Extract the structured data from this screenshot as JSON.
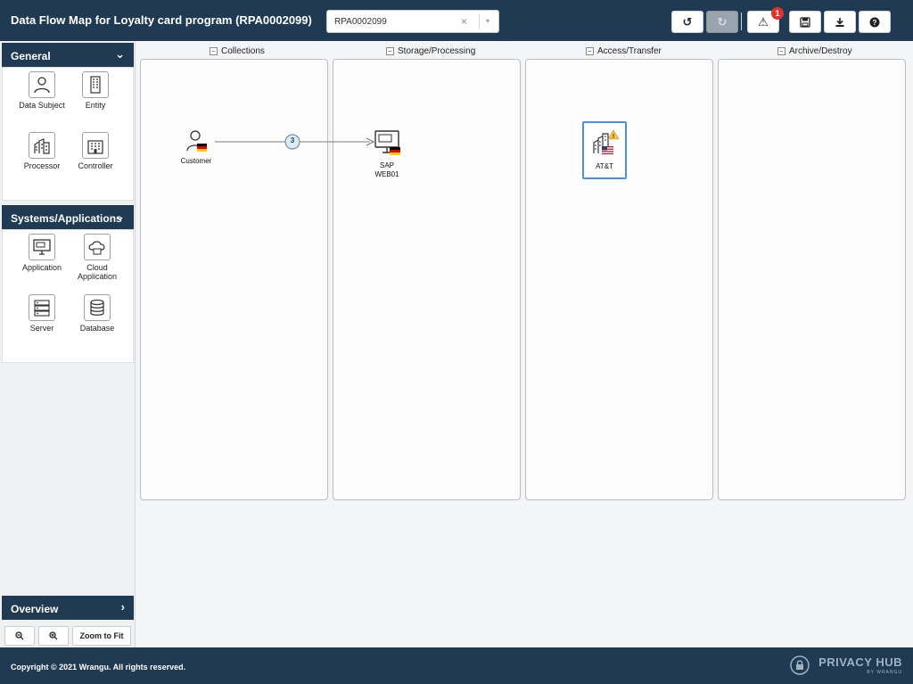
{
  "header": {
    "title": "Data Flow Map for Loyalty card program (RPA0002099)",
    "select": {
      "value": "RPA0002099",
      "clear": "×",
      "caret": "▾"
    },
    "buttons": {
      "undo": "↺",
      "redo": "↻",
      "alerts": "⚠",
      "save": "💾",
      "download": "⤓",
      "help": "?"
    },
    "alert_count": "1"
  },
  "sidebar": {
    "general": {
      "label": "General",
      "items": [
        {
          "label": "Data Subject",
          "icon": "person-icon"
        },
        {
          "label": "Entity",
          "icon": "building-icon"
        },
        {
          "label": "Processor",
          "icon": "factory-icon"
        },
        {
          "label": "Controller",
          "icon": "office-icon"
        }
      ]
    },
    "systems": {
      "label": "Systems/Applications",
      "items": [
        {
          "label": "Application",
          "icon": "monitor-icon"
        },
        {
          "label": "Cloud Application",
          "icon": "cloud-icon"
        },
        {
          "label": "Server",
          "icon": "server-icon"
        },
        {
          "label": "Database",
          "icon": "database-icon"
        }
      ]
    },
    "overview": {
      "label": "Overview"
    },
    "zoom": {
      "zoom_out": "🔍-",
      "zoom_in": "🔍+",
      "fit": "Zoom to Fit"
    }
  },
  "canvas": {
    "lanes": [
      {
        "title": "Collections"
      },
      {
        "title": "Storage/Processing"
      },
      {
        "title": "Access/Transfer"
      },
      {
        "title": "Archive/Destroy"
      }
    ],
    "nodes": {
      "customer": {
        "label": "Customer"
      },
      "sap": {
        "label1": "SAP",
        "label2": "WEB01"
      },
      "att": {
        "label": "AT&T"
      }
    },
    "flow_count": "3"
  },
  "footer": {
    "copyright": "Copyright © 2021 Wrangu. All rights reserved.",
    "brand": "PRIVACY HUB",
    "brand_sub": "BY WRANGU"
  },
  "colors": {
    "navy": "#1f3a52",
    "accent_blue": "#4a90e2",
    "alert_red": "#e0322f"
  }
}
